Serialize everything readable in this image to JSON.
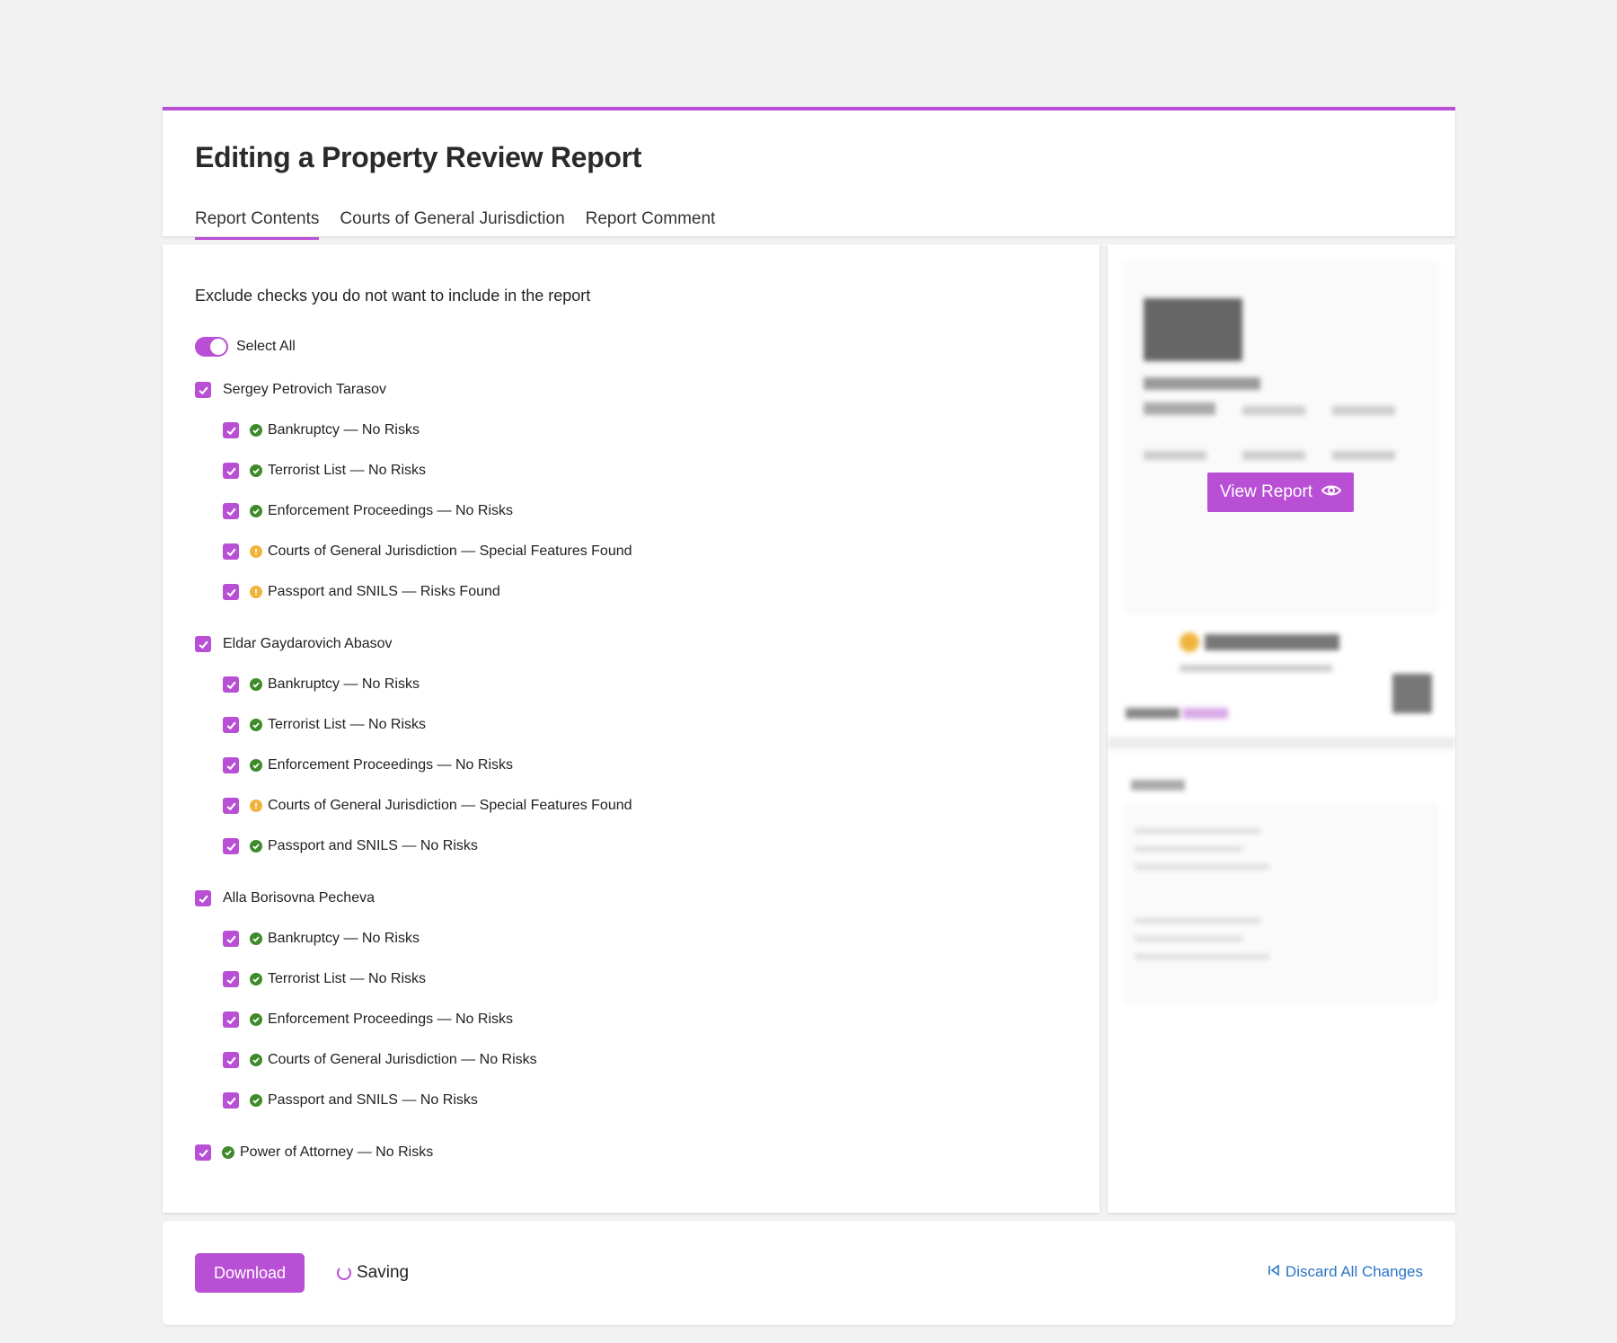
{
  "header": {
    "title": "Editing a Property Review Report",
    "tabs": [
      {
        "label": "Report Contents",
        "active": true
      },
      {
        "label": "Courts of General Jurisdiction",
        "active": false
      },
      {
        "label": "Report Comment",
        "active": false
      }
    ]
  },
  "main": {
    "instruction": "Exclude checks you do not want to include in the report",
    "select_all_label": "Select All",
    "select_all_on": true,
    "persons": [
      {
        "name": "Sergey Petrovich Tarasov",
        "checked": true,
        "checks": [
          {
            "label": "Bankruptcy — No Risks",
            "status": "ok",
            "checked": true
          },
          {
            "label": "Terrorist List — No Risks",
            "status": "ok",
            "checked": true
          },
          {
            "label": "Enforcement Proceedings — No Risks",
            "status": "ok",
            "checked": true
          },
          {
            "label": "Courts of General Jurisdiction — Special Features Found",
            "status": "warn",
            "checked": true
          },
          {
            "label": "Passport and SNILS — Risks Found",
            "status": "warn",
            "checked": true
          }
        ]
      },
      {
        "name": "Eldar Gaydarovich Abasov",
        "checked": true,
        "checks": [
          {
            "label": "Bankruptcy — No Risks",
            "status": "ok",
            "checked": true
          },
          {
            "label": "Terrorist List — No Risks",
            "status": "ok",
            "checked": true
          },
          {
            "label": "Enforcement Proceedings — No Risks",
            "status": "ok",
            "checked": true
          },
          {
            "label": "Courts of General Jurisdiction — Special Features Found",
            "status": "warn",
            "checked": true
          },
          {
            "label": "Passport and SNILS — No Risks",
            "status": "ok",
            "checked": true
          }
        ]
      },
      {
        "name": "Alla Borisovna Pecheva",
        "checked": true,
        "checks": [
          {
            "label": "Bankruptcy — No Risks",
            "status": "ok",
            "checked": true
          },
          {
            "label": "Terrorist List — No Risks",
            "status": "ok",
            "checked": true
          },
          {
            "label": "Enforcement Proceedings — No Risks",
            "status": "ok",
            "checked": true
          },
          {
            "label": "Courts of General Jurisdiction — No Risks",
            "status": "ok",
            "checked": true
          },
          {
            "label": "Passport and SNILS — No Risks",
            "status": "ok",
            "checked": true
          }
        ]
      }
    ],
    "extra_check": {
      "label": "Power of Attorney — No Risks",
      "status": "ok",
      "checked": true
    }
  },
  "preview": {
    "view_report_label": "View Report"
  },
  "footer": {
    "download_label": "Download",
    "saving_label": "Saving",
    "discard_label": "Discard All Changes"
  },
  "colors": {
    "accent": "#b84fd4",
    "ok": "#3f8a2b",
    "warn": "#f0b43c",
    "link": "#2a74c7"
  }
}
